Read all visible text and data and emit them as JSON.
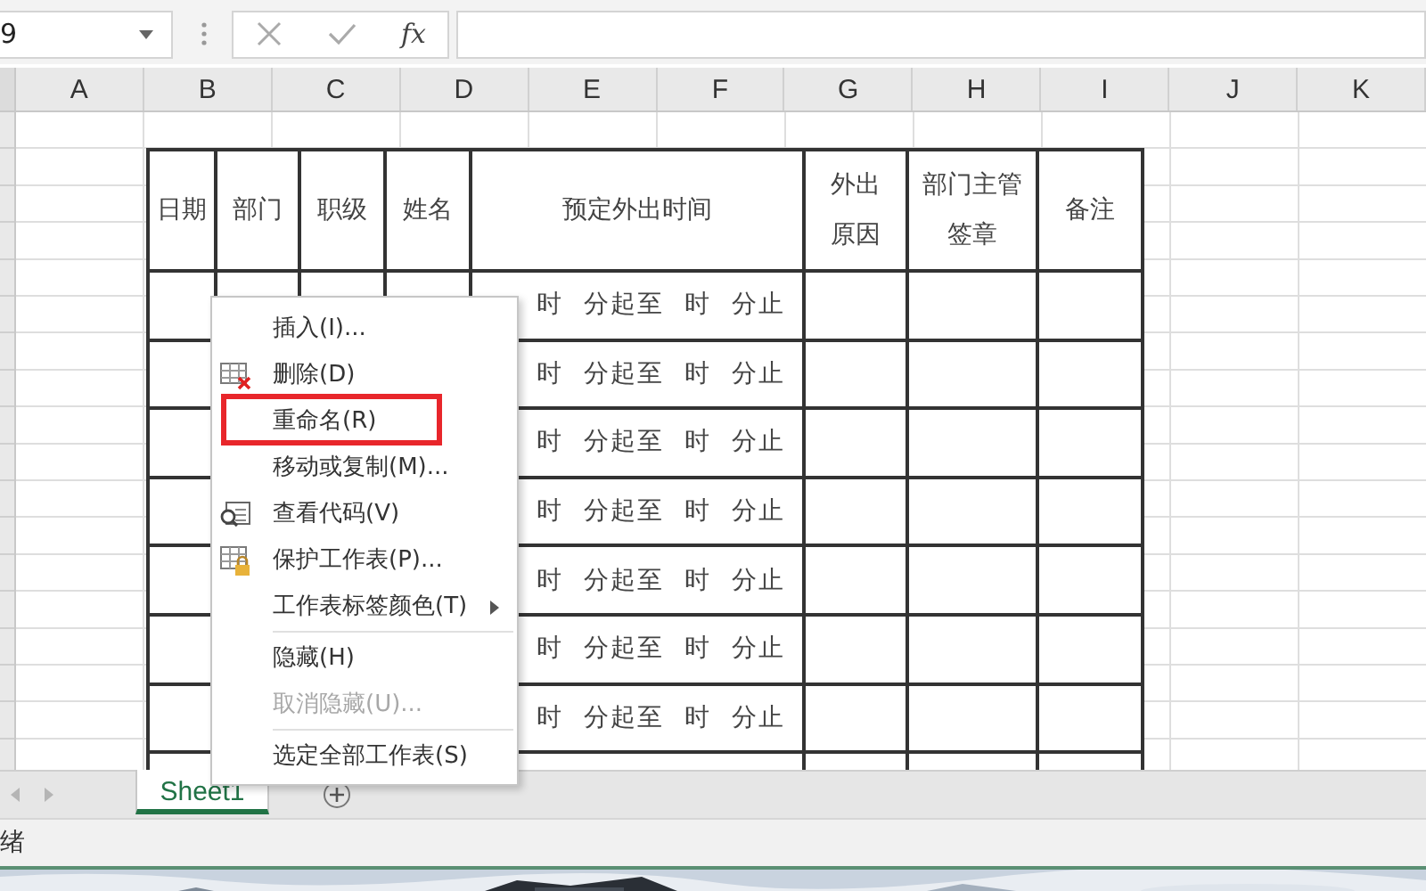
{
  "formula_bar": {
    "name_box": "9",
    "function_label": "fx"
  },
  "column_headers": [
    "A",
    "B",
    "C",
    "D",
    "E",
    "F",
    "G",
    "H",
    "I",
    "J",
    "K"
  ],
  "form_table": {
    "headers": [
      [
        "日期"
      ],
      [
        "部门"
      ],
      [
        "职级"
      ],
      [
        "姓名"
      ],
      [
        "预定外出时间"
      ],
      [
        "外出",
        "原因"
      ],
      [
        "部门主管",
        "签章"
      ],
      [
        "备注"
      ]
    ],
    "rows": [
      {
        "time": "时 分起至 时 分止"
      },
      {
        "time": "时 分起至 时 分止"
      },
      {
        "time": "时 分起至 时 分止"
      },
      {
        "time": "时 分起至 时 分止"
      },
      {
        "time": "时 分起至 时 分止"
      },
      {
        "time": "时 分起至 时 分止"
      },
      {
        "time": "时 分起至 时 分止"
      }
    ]
  },
  "context_menu": {
    "items": [
      {
        "kind": "plain",
        "label": "插入(I)...",
        "disabled": false,
        "highlighted": false
      },
      {
        "kind": "delete",
        "label": "删除(D)",
        "disabled": false,
        "highlighted": false
      },
      {
        "kind": "plain",
        "label": "重命名(R)",
        "disabled": false,
        "highlighted": true
      },
      {
        "kind": "plain",
        "label": "移动或复制(M)...",
        "disabled": false,
        "highlighted": false
      },
      {
        "kind": "code",
        "label": "查看代码(V)",
        "disabled": false,
        "highlighted": false
      },
      {
        "kind": "protect",
        "label": "保护工作表(P)...",
        "disabled": false,
        "highlighted": false
      },
      {
        "kind": "submenu",
        "label": "工作表标签颜色(T)",
        "disabled": false,
        "highlighted": false
      },
      {
        "kind": "separator"
      },
      {
        "kind": "plain",
        "label": "隐藏(H)",
        "disabled": false,
        "highlighted": false
      },
      {
        "kind": "plain",
        "label": "取消隐藏(U)...",
        "disabled": true,
        "highlighted": false
      },
      {
        "kind": "separator"
      },
      {
        "kind": "plain",
        "label": "选定全部工作表(S)",
        "disabled": false,
        "highlighted": false
      }
    ]
  },
  "sheet_tabs": [
    {
      "label": "Sheet1",
      "selected": true
    }
  ],
  "status_bar": {
    "text": "绪"
  }
}
